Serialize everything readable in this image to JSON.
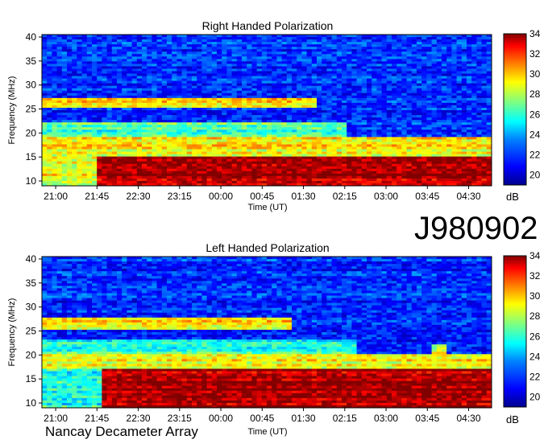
{
  "observation_id": "J980902",
  "instrument": "Nancay Decameter Array",
  "colorbar": {
    "unit": "dB",
    "ticks": [
      20,
      22,
      24,
      26,
      28,
      30,
      32,
      34
    ],
    "range": [
      19,
      34
    ],
    "colors": [
      "#00008f",
      "#0000ff",
      "#0080ff",
      "#00ffff",
      "#80ff80",
      "#ffff00",
      "#ff8000",
      "#ff0000",
      "#800000"
    ]
  },
  "chart_data": [
    {
      "type": "heatmap",
      "title": "Right Handed Polarization",
      "xlabel": "Time (UT)",
      "ylabel": "Frequency (MHz)",
      "xticks": [
        "21:00",
        "21:45",
        "22:30",
        "23:15",
        "00:00",
        "00:45",
        "01:30",
        "02:15",
        "03:00",
        "03:45",
        "04:30"
      ],
      "yticks": [
        10,
        15,
        20,
        25,
        30,
        35,
        40
      ],
      "ylim": [
        9,
        40.5
      ],
      "xlim": [
        "20:45",
        "04:55"
      ],
      "emission_bands": [
        {
          "freq": [
            9,
            15
          ],
          "time": [
            "21:45",
            "04:55"
          ],
          "level_db": 33.5
        },
        {
          "freq": [
            9,
            15
          ],
          "time": [
            "20:45",
            "21:45"
          ],
          "level_db": 28
        },
        {
          "freq": [
            15,
            19
          ],
          "time": [
            "20:45",
            "04:55"
          ],
          "level_db": 28.5
        },
        {
          "freq": [
            19,
            22
          ],
          "time": [
            "20:45",
            "02:15"
          ],
          "level_db": 25.5
        },
        {
          "freq": [
            25.5,
            27.5
          ],
          "time": [
            "20:45",
            "01:45"
          ],
          "level_db": 28.5
        }
      ]
    },
    {
      "type": "heatmap",
      "title": "Left Handed Polarization",
      "xlabel": "Time (UT)",
      "ylabel": "Frequency (MHz)",
      "xticks": [
        "21:00",
        "21:45",
        "22:30",
        "23:15",
        "00:00",
        "00:45",
        "01:30",
        "02:15",
        "03:00",
        "03:45",
        "04:30"
      ],
      "yticks": [
        10,
        15,
        20,
        25,
        30,
        35,
        40
      ],
      "ylim": [
        9,
        40.5
      ],
      "xlim": [
        "20:45",
        "04:55"
      ],
      "emission_bands": [
        {
          "freq": [
            9,
            17
          ],
          "time": [
            "21:50",
            "04:55"
          ],
          "level_db": 33.5
        },
        {
          "freq": [
            9,
            17
          ],
          "time": [
            "20:45",
            "21:50"
          ],
          "level_db": 25
        },
        {
          "freq": [
            17,
            20
          ],
          "time": [
            "20:45",
            "04:55"
          ],
          "level_db": 28.5
        },
        {
          "freq": [
            20,
            23
          ],
          "time": [
            "20:45",
            "02:30"
          ],
          "level_db": 25.5
        },
        {
          "freq": [
            25.5,
            28
          ],
          "time": [
            "20:45",
            "01:15"
          ],
          "level_db": 28.5
        },
        {
          "freq": [
            12,
            22
          ],
          "time": [
            "03:50",
            "04:05"
          ],
          "level_db": 28
        }
      ]
    }
  ]
}
